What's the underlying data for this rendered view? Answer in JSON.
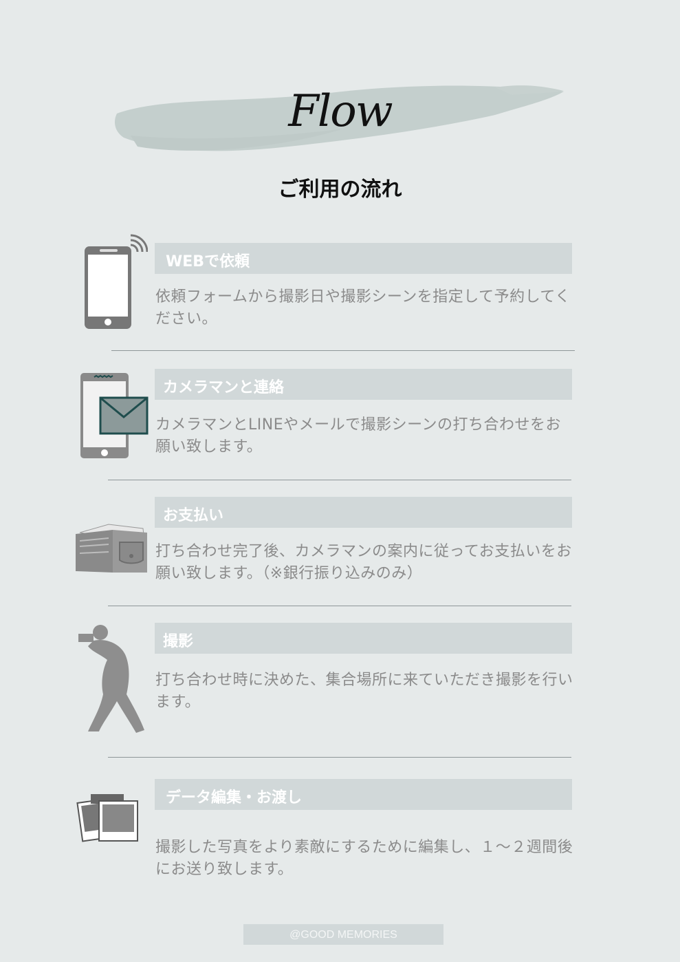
{
  "title": "Flow",
  "subtitle": "ご利用の流れ",
  "steps": [
    {
      "heading": "WEBで依頼",
      "text": "依頼フォームから撮影日や撮影シーンを指定して予約してください。",
      "icon": "smartphone-icon"
    },
    {
      "heading": "カメラマンと連絡",
      "text": "カメラマンとLINEやメールで撮影シーンの打ち合わせをお願い致します。",
      "icon": "message-phone-icon"
    },
    {
      "heading": "お支払い",
      "text": "打ち合わせ完了後、カメラマンの案内に従ってお支払いをお願い致します。（※銀行振り込みのみ）",
      "icon": "wallet-icon"
    },
    {
      "heading": "撮影",
      "text": "打ち合わせ時に決めた、集合場所に来ていただき撮影を行います。",
      "icon": "photographer-icon"
    },
    {
      "heading": "データ編集・お渡し",
      "text": "撮影した写真をより素敵にするために編集し、１～２週間後にお送り致します。",
      "icon": "photos-icon"
    }
  ],
  "footer": "@GOOD MEMORIES",
  "colors": {
    "background": "#e6eaea",
    "header_bar": "#d1d8d9",
    "body_text": "#8b8b8b",
    "icon_gray": "#8e8e8e",
    "accent": "#1f4d4d"
  }
}
